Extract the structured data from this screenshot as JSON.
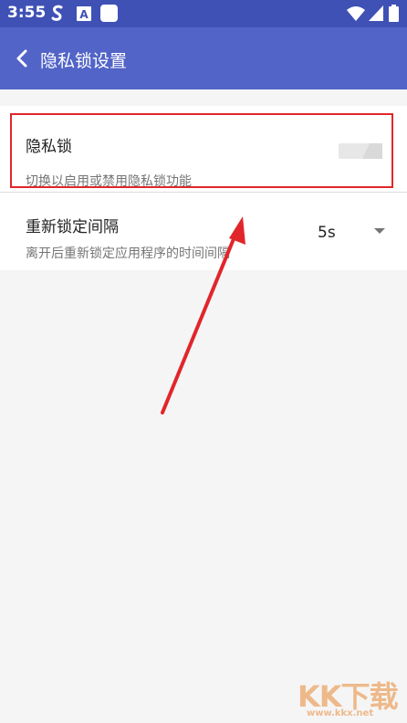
{
  "status_bar": {
    "time": "3:55",
    "icons": [
      "s-notification-icon",
      "a-notification-icon",
      "square-notification-icon",
      "wifi-icon",
      "signal-icon",
      "battery-icon"
    ]
  },
  "app_bar": {
    "title": "隐私锁设置",
    "back_icon": "chevron-left-icon"
  },
  "settings": {
    "privacy_lock": {
      "label": "隐私锁",
      "summary": "切换以启用或禁用隐私锁功能",
      "enabled": false
    },
    "relock_interval": {
      "label": "重新锁定间隔",
      "summary": "离开后重新锁定应用程序的时间间隔",
      "value": "5s"
    }
  },
  "colors": {
    "status_bar": "#3f51b5",
    "app_bar": "#5264c7",
    "highlight": "#e1262b",
    "arrow": "#e1262b",
    "background": "#f5f5f5"
  },
  "watermark": {
    "logo": "KK下载",
    "url": "www.kkx.net"
  }
}
